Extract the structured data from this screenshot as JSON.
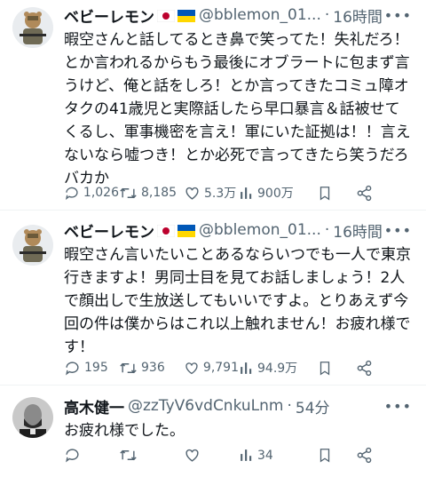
{
  "tweets": [
    {
      "author_name": "ベビーレモン",
      "handle": "@bblemon_01...",
      "time": "16時間",
      "text": "暇空さんと話してるとき鼻で笑ってた！失礼だろ！とか言われるからもう最後にオブラートに包まず言うけど、俺と話をしろ！とか言ってきたコミュ障オタクの41歳児と実際話したら早口暴言＆話被せてくるし、軍事機密を言え！軍にいた証拠は！！言えないなら嘘つき！とか必死で言ってきたら笑うだろバカか",
      "stats": {
        "replies": "1,026",
        "reposts": "8,185",
        "likes": "5.3万",
        "views": "900万"
      }
    },
    {
      "author_name": "ベビーレモン",
      "handle": "@bblemon_01...",
      "time": "16時間",
      "text": "暇空さん言いたいことあるならいつでも一人で東京行きますよ！男同士目を見てお話しましょう！2人で顔出しで生放送してもいいですよ。とりあえず今回の件は僕からはこれ以上触れません！お疲れ様です！",
      "stats": {
        "replies": "195",
        "reposts": "936",
        "likes": "9,791",
        "views": "94.9万"
      }
    },
    {
      "author_name": "高木健一",
      "handle": "@zzTyV6vdCnkuLnm",
      "time": "54分",
      "text": "お疲れ様でした。",
      "stats": {
        "replies": "",
        "reposts": "",
        "likes": "",
        "views": "34"
      }
    }
  ],
  "separator": "·",
  "more_icon": "more-icon",
  "colors": {
    "text": "#0f1419",
    "secondary": "#536471",
    "divider": "#eff3f4",
    "jp_red": "#bc002d",
    "ua_blue": "#0057b7",
    "ua_yellow": "#ffd700"
  }
}
